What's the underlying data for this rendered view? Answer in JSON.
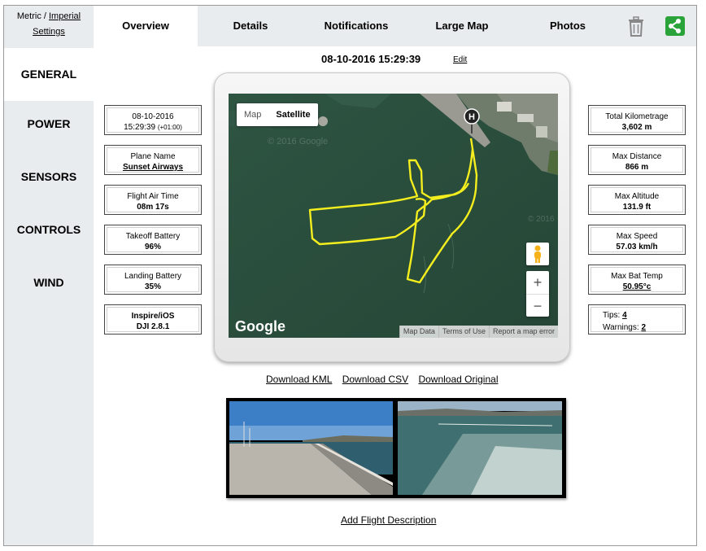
{
  "units": {
    "metric": "Metric",
    "sep": " / ",
    "imperial": "Imperial",
    "settings": "Settings"
  },
  "tabs": [
    "Overview",
    "Details",
    "Notifications",
    "Large Map",
    "Photos"
  ],
  "nav": [
    "GENERAL",
    "POWER",
    "SENSORS",
    "CONTROLS",
    "WIND"
  ],
  "flight_datetime": "08-10-2016 15:29:39",
  "edit_label": "Edit",
  "left_cards": {
    "date": {
      "l1": "08-10-2016",
      "l2": "15:29:39",
      "tz": "(+01:00)"
    },
    "plane": {
      "l1": "Plane Name",
      "l2": "Sunset Airways"
    },
    "airtime": {
      "l1": "Flight Air Time",
      "l2": "08m 17s"
    },
    "takeoff": {
      "l1": "Takeoff Battery",
      "l2": "96%"
    },
    "landing": {
      "l1": "Landing Battery",
      "l2": "35%"
    },
    "device": {
      "l1": "Inspire/iOS",
      "l2": "DJI 2.8.1"
    }
  },
  "right_cards": {
    "km": {
      "l1": "Total Kilometrage",
      "l2": "3,602 m"
    },
    "dist": {
      "l1": "Max Distance",
      "l2": "866 m"
    },
    "alt": {
      "l1": "Max Altitude",
      "l2": "131.9 ft"
    },
    "speed": {
      "l1": "Max Speed",
      "l2": "57.03 km/h"
    },
    "temp": {
      "l1": "Max Bat Temp",
      "l2": "50.95°c"
    },
    "tips": {
      "tips_label": "Tips:",
      "tips_count": "4",
      "warn_label": "Warnings:",
      "warn_count": "2"
    }
  },
  "map": {
    "type_map": "Map",
    "type_sat": "Satellite",
    "logo": "Google",
    "watermark": "© 2016 Google",
    "watermark2": "© 2016",
    "home_marker": "H",
    "zoom_in": "+",
    "zoom_out": "−",
    "footer": [
      "Map Data",
      "Terms of Use",
      "Report a map error"
    ]
  },
  "downloads": [
    "Download KML",
    "Download CSV",
    "Download Original"
  ],
  "add_flight": "Add Flight Description",
  "colors": {
    "track": "#f4ee1f",
    "share": "#2aa33a",
    "panel": "#e9ecee"
  },
  "icons": {
    "trash": "trash-icon",
    "share": "share-icon",
    "pegman": "pegman-icon"
  }
}
